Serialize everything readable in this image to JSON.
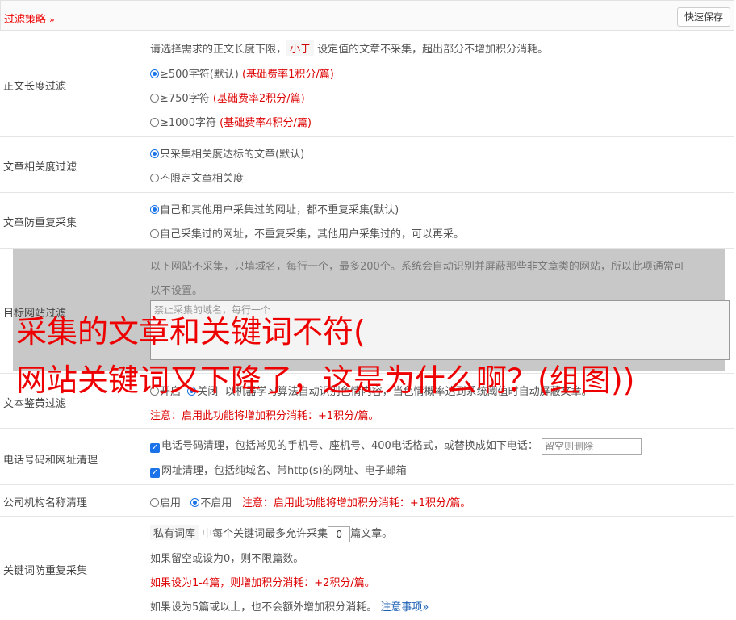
{
  "header": {
    "title": "过滤策略",
    "chevron": "»",
    "save_label": "快速保存"
  },
  "length_filter": {
    "label": "正文长度过滤",
    "desc_pre": "请选择需求的正文长度下限，",
    "desc_tag": "小于",
    "desc_post": "设定值的文章不采集，超出部分不增加积分消耗。",
    "options": [
      {
        "text": "≥500字符(默认)",
        "note": "(基础费率1积分/篇)"
      },
      {
        "text": "≥750字符",
        "note": "(基础费率2积分/篇)"
      },
      {
        "text": "≥1000字符",
        "note": "(基础费率4积分/篇)"
      }
    ]
  },
  "relevance": {
    "label": "文章相关度过滤",
    "options": [
      "只采集相关度达标的文章(默认)",
      "不限定文章相关度"
    ]
  },
  "dedupe": {
    "label": "文章防重复采集",
    "options": [
      "自己和其他用户采集过的网址，都不重复采集(默认)",
      "自己采集过的网址，不重复采集，其他用户采集过的，可以再采。"
    ]
  },
  "site_filter": {
    "label": "目标网站过滤",
    "desc1": "以下网站不采集，只填域名，每行一个，最多200个。系统会自动识别并屏蔽那些非文章类的网站，所以此项通常可",
    "desc2": "以不设置。",
    "placeholder": "禁止采集的域名，每行一个"
  },
  "porn_filter": {
    "label": "文本鉴黄过滤",
    "opt_on": "开启",
    "opt_off": "关闭",
    "desc": "以机器学习算法自动识别色情内容，当色情概率达到系统阈值时自动屏蔽文章。",
    "note": "注意：启用此功能将增加积分消耗：+1积分/篇。"
  },
  "phone_filter": {
    "label": "电话号码和网址清理",
    "opt1": "电话号码清理，包括常见的手机号、座机号、400电话格式，或替换成如下电话：",
    "opt1_input": "留空则删除",
    "opt2": "网址清理，包括纯域名、带http(s)的网址、电子邮箱"
  },
  "company_filter": {
    "label": "公司机构名称清理",
    "opt_on": "启用",
    "opt_off": "不启用",
    "note": "注意：启用此功能将增加积分消耗：+1积分/篇。"
  },
  "keyword_dedupe": {
    "label": "关键词防重复采集",
    "tag": "私有词库",
    "line1_pre": "中每个关键词最多允许采集",
    "value": "0",
    "line1_post": "篇文章。",
    "line2": "如果留空或设为0，则不限篇数。",
    "line3": "如果设为1-4篇，则增加积分消耗：+2积分/篇。",
    "line4": "如果设为5篇或以上，也不会额外增加积分消耗。",
    "link": "注意事项"
  },
  "watermark": {
    "line1": "采集的文章和关键词不符(",
    "line2": "网站关键词又下降了，这是为什么啊？(组图))"
  }
}
